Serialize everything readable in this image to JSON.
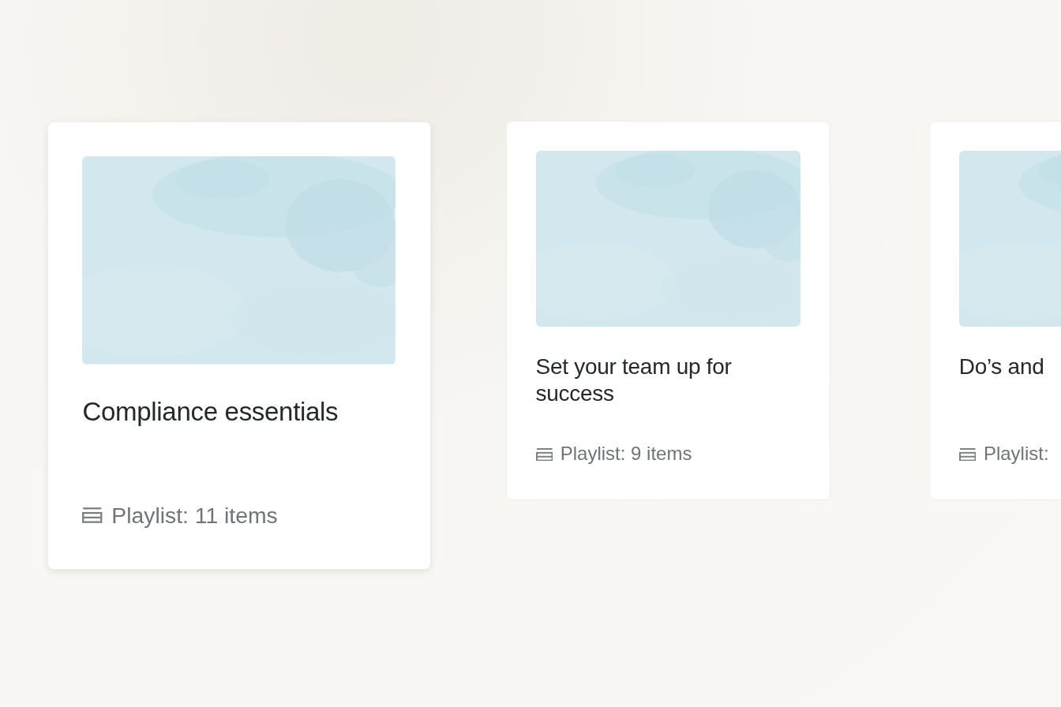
{
  "cards": [
    {
      "title": "Compliance essentials",
      "meta": "Playlist: 11 items",
      "highlighted": true
    },
    {
      "title": "Set your team up for success",
      "meta": "Playlist: 9 items",
      "highlighted": false
    },
    {
      "title": "Do’s and",
      "meta": "Playlist:",
      "highlighted": false
    }
  ]
}
